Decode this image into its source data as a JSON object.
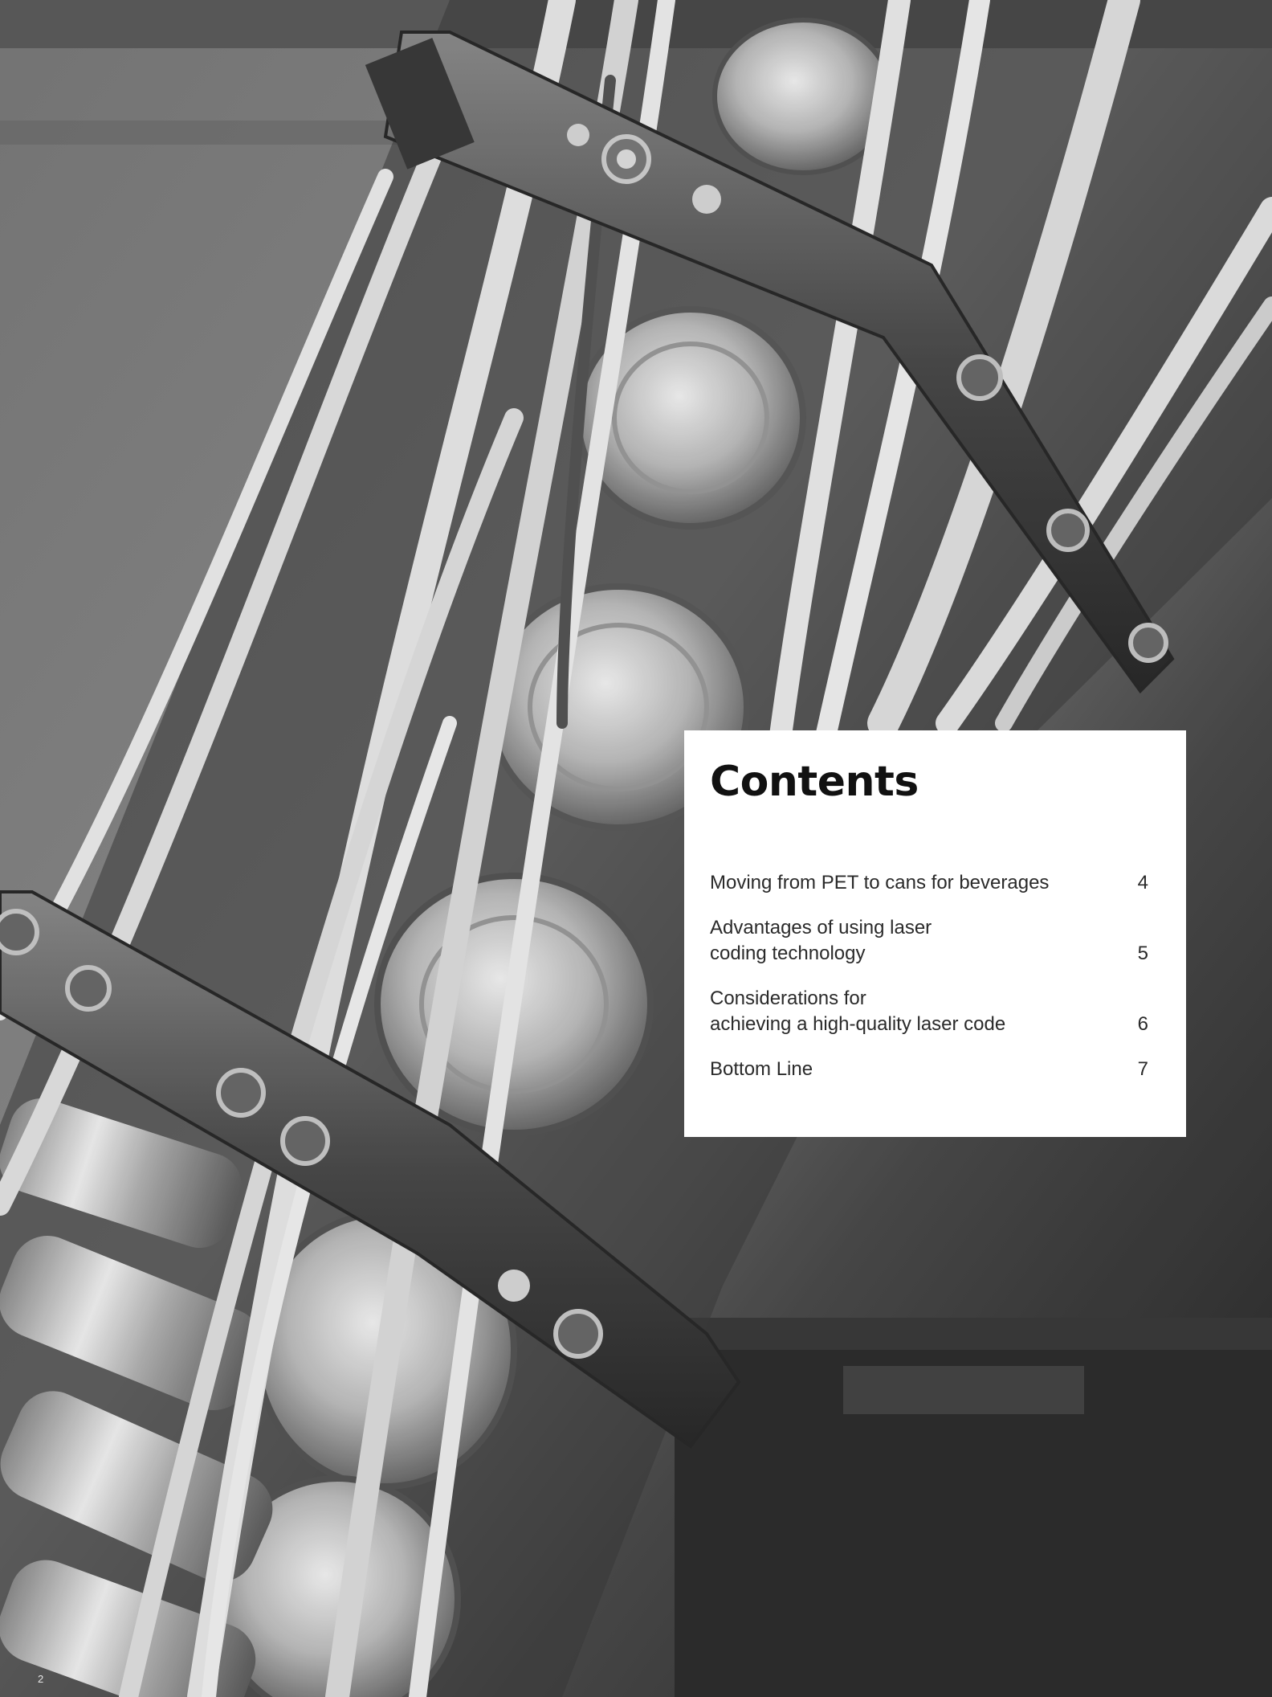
{
  "photo": {
    "subject": "beverage-can-conveyor-photo",
    "palette": {
      "background_dark": "#2b2b2b",
      "background_mid": "#6e6e6e",
      "rail_white": "#e9e9e9",
      "metal_dark": "#3a3a3a",
      "can_silver": "#cfcfcf"
    }
  },
  "contents": {
    "title": "Contents",
    "entries": [
      {
        "lines": [
          "Moving from PET to cans for beverages"
        ],
        "page": "4"
      },
      {
        "lines": [
          "Advantages of using laser",
          "coding technology"
        ],
        "page": "5"
      },
      {
        "lines": [
          "Considerations for",
          "achieving a high-quality laser code"
        ],
        "page": "6"
      },
      {
        "lines": [
          "Bottom Line"
        ],
        "page": "7"
      }
    ]
  },
  "footer": {
    "page_number": "2"
  }
}
